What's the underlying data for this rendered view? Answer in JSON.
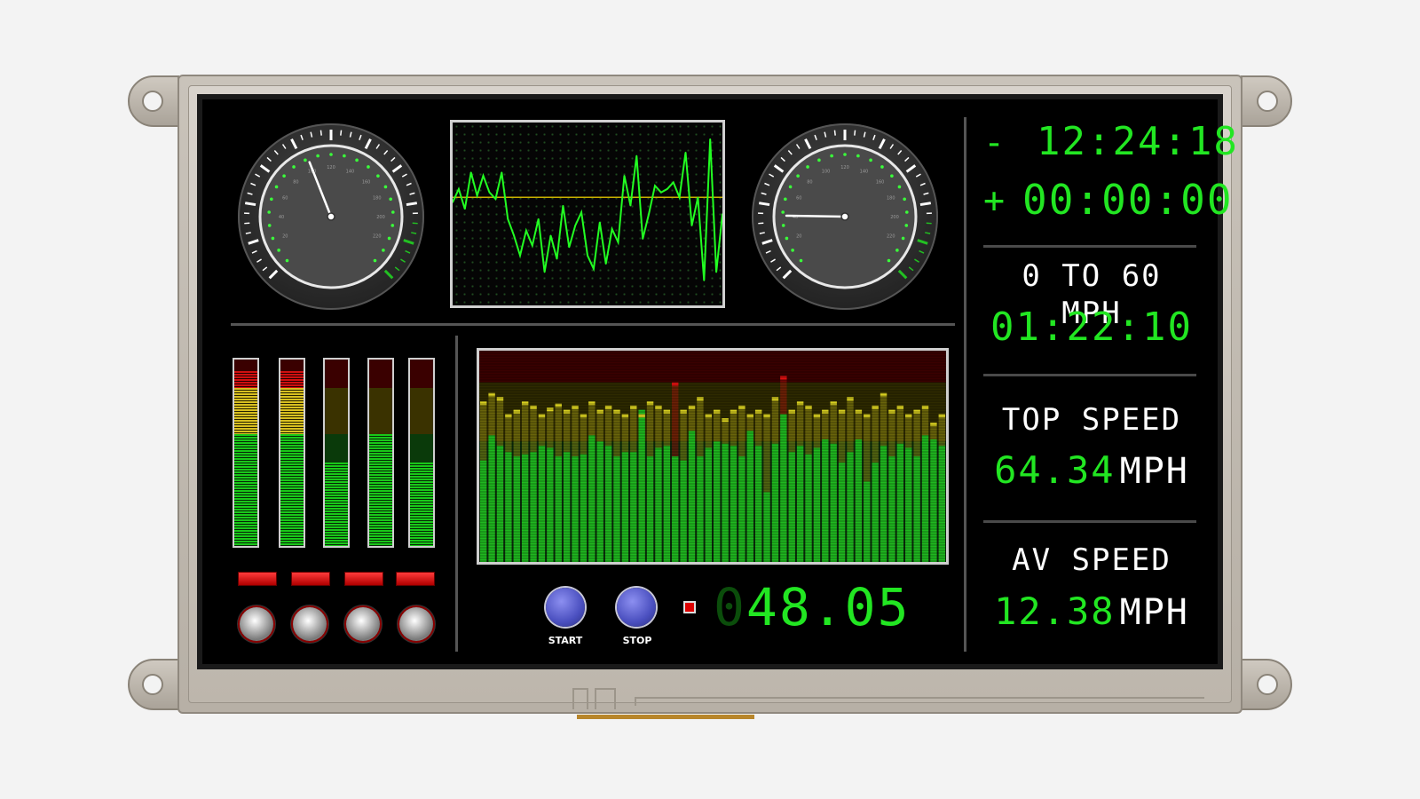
{
  "clock": {
    "remaining_sign": "-",
    "remaining": "12:24:18",
    "elapsed_sign": "+",
    "elapsed": "00:00:00"
  },
  "stats": {
    "zero_to_sixty_label": "0 TO 60 MPH",
    "zero_to_sixty_value": "01:22:10",
    "top_speed_label": "TOP SPEED",
    "top_speed_value": "64.34",
    "top_speed_unit": "MPH",
    "av_speed_label": "AV SPEED",
    "av_speed_value": "12.38",
    "av_speed_unit": "MPH"
  },
  "controls": {
    "start_label": "START",
    "stop_label": "STOP",
    "counter_leading": "0",
    "counter_value": "48.05"
  },
  "gauges": {
    "left": {
      "tick_labels": [
        "20",
        "40",
        "60",
        "80",
        "100",
        "120",
        "140",
        "160",
        "180",
        "200",
        "220"
      ],
      "fraction": 0.42
    },
    "right": {
      "tick_labels": [
        "20",
        "40",
        "60",
        "80",
        "100",
        "120",
        "140",
        "160",
        "180",
        "200",
        "220"
      ],
      "fraction": 0.17
    }
  },
  "meters": {
    "levels": [
      0.94,
      0.94,
      0.45,
      0.6,
      0.45
    ]
  },
  "colors": {
    "lcd_green": "#22e622",
    "bezel": "#c0bab0",
    "screen": "#000000",
    "button_blue": "#4a4fbf",
    "led_red": "#dd0000"
  },
  "chart_data": [
    {
      "type": "line",
      "x": [
        0,
        1,
        2,
        3,
        4,
        5,
        6,
        7,
        8,
        9,
        10,
        11,
        12,
        13,
        14,
        15,
        16,
        17,
        18,
        19,
        20,
        21,
        22,
        23,
        24,
        25,
        26,
        27,
        28,
        29,
        30,
        31,
        32,
        33,
        34,
        35,
        36,
        37,
        38,
        39,
        40,
        41,
        42,
        43,
        44
      ],
      "series": [
        {
          "values": [
            62,
            70,
            58,
            80,
            66,
            78,
            68,
            64,
            80,
            52,
            42,
            30,
            45,
            36,
            52,
            20,
            42,
            28,
            60,
            35,
            48,
            56,
            30,
            22,
            50,
            25,
            46,
            38,
            78,
            60,
            90,
            40,
            55,
            72,
            68,
            70,
            74,
            65,
            92,
            48,
            65,
            15,
            100,
            20,
            55
          ]
        }
      ],
      "threshold": 65,
      "ylim": [
        0,
        110
      ],
      "grid": true
    },
    {
      "type": "bar",
      "x": [
        0,
        1,
        2,
        3,
        4,
        5,
        6,
        7,
        8,
        9,
        10,
        11,
        12,
        13,
        14,
        15,
        16,
        17,
        18,
        19,
        20,
        21,
        22,
        23,
        24,
        25,
        26,
        27,
        28,
        29,
        30,
        31,
        32,
        33,
        34,
        35,
        36,
        37,
        38,
        39,
        40,
        41,
        42,
        43,
        44,
        45,
        46,
        47,
        48,
        49,
        50,
        51,
        52,
        53,
        54,
        55
      ],
      "values": [
        48,
        60,
        55,
        52,
        50,
        51,
        52,
        55,
        54,
        50,
        52,
        50,
        51,
        60,
        57,
        55,
        50,
        52,
        52,
        72,
        50,
        54,
        55,
        50,
        48,
        62,
        50,
        54,
        57,
        56,
        55,
        50,
        62,
        55,
        33,
        56,
        70,
        52,
        55,
        51,
        54,
        58,
        56,
        47,
        52,
        58,
        38,
        47,
        55,
        50,
        56,
        54,
        50,
        60,
        58,
        55
      ],
      "peaks": [
        76,
        80,
        78,
        70,
        72,
        76,
        74,
        70,
        73,
        75,
        72,
        74,
        70,
        76,
        72,
        74,
        72,
        70,
        74,
        70,
        76,
        74,
        72,
        85,
        72,
        74,
        78,
        70,
        72,
        68,
        72,
        74,
        70,
        72,
        70,
        78,
        88,
        72,
        76,
        74,
        70,
        72,
        76,
        72,
        78,
        72,
        70,
        74,
        80,
        72,
        74,
        70,
        72,
        74,
        66,
        70
      ],
      "ylim": [
        0,
        100
      ]
    }
  ]
}
